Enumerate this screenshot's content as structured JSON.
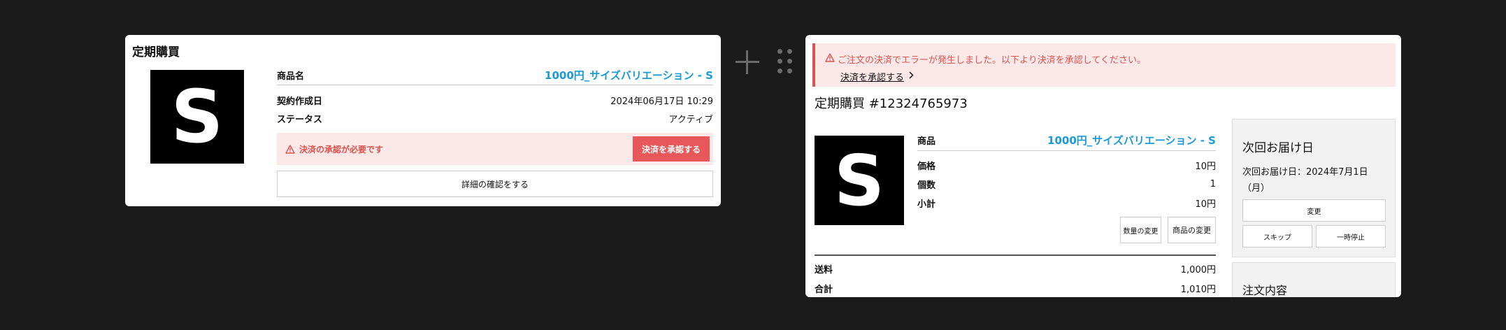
{
  "left_card": {
    "title": "定期購買",
    "thumb_letter": "S",
    "product_label": "商品名",
    "product_value": "1000円_サイズバリエーション - S",
    "contract_label": "契約作成日",
    "contract_value": "2024年06月17日 10:29",
    "status_label": "ステータス",
    "status_value": "アクティブ",
    "warning_text": "決済の承認が必要です",
    "approve_button": "決済を承認する",
    "detail_button": "詳細の確認をする"
  },
  "right_card": {
    "error_message": "ご注文の決済でエラーが発生しました。以下より決済を承認してください。",
    "error_link": "決済を承認する",
    "title": "定期購買 #12324765973",
    "thumb_letter": "S",
    "product_label": "商品",
    "product_value": "1000円_サイズバリエーション - S",
    "price_label": "価格",
    "price_value": "10円",
    "qty_label": "個数",
    "qty_value": "1",
    "subtotal_label": "小計",
    "subtotal_value": "10円",
    "qty_change_button": "数量の変更",
    "product_change_button": "商品の変更",
    "shipping_label": "送料",
    "shipping_value": "1,000円",
    "total_label": "合計",
    "total_value": "1,010円",
    "next_delivery": {
      "title": "次回お届け日",
      "text": "次回お届け日：2024年7月1日（月）",
      "change_button": "変更",
      "skip_button": "スキップ",
      "pause_button": "一時停止"
    },
    "order_content_title": "注文内容"
  },
  "colors": {
    "background": "#1b1b1b",
    "link": "#1a9ad6",
    "error": "#d9534f",
    "error_bg": "#fde8e8",
    "approve_button": "#e8585a"
  }
}
